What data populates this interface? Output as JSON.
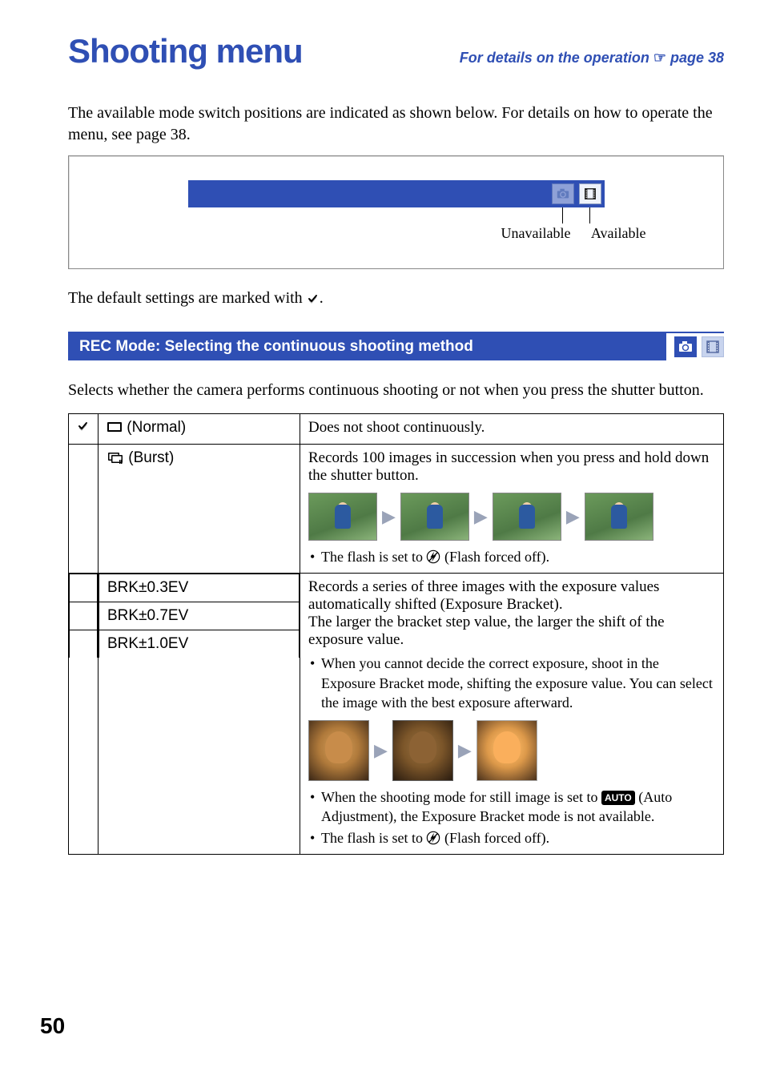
{
  "header": {
    "chapter_title": "Shooting menu",
    "ref_prefix": "For details on the operation ",
    "ref_page": "page 38"
  },
  "intro": {
    "text": "The available mode switch positions are indicated as shown below. For details on how to operate the menu, see page 38."
  },
  "diagram": {
    "unavailable_label": "Unavailable",
    "available_label": "Available"
  },
  "default_line": {
    "prefix": "The default settings are marked with ",
    "suffix": "."
  },
  "section": {
    "title": "REC Mode: Selecting the continuous shooting method",
    "description": "Selects whether the camera performs continuous shooting or not when you press the shutter button."
  },
  "table": {
    "normal": {
      "label": " (Normal)",
      "desc": "Does not shoot continuously."
    },
    "burst": {
      "label": " (Burst)",
      "desc": "Records 100 images in succession when you press and hold down the shutter button.",
      "note1_a": "The flash is set to ",
      "note1_b": " (Flash forced off)."
    },
    "brk": {
      "opt1": "BRK±0.3EV",
      "opt2": "BRK±0.7EV",
      "opt3": "BRK±1.0EV",
      "desc_p1": "Records a series of three images with the exposure values automatically shifted (Exposure Bracket).",
      "desc_p2": "The larger the bracket step value, the larger the shift of the exposure value.",
      "note_expo": "When you cannot decide the correct exposure, shoot in the Exposure Bracket mode, shifting the exposure value. You can select the image with the best exposure afterward.",
      "note_auto_a": "When the shooting mode for still image is set to ",
      "note_auto_b": " (Auto Adjustment), the Exposure Bracket mode is not available.",
      "note_flash_a": "The flash is set to ",
      "note_flash_b": " (Flash forced off).",
      "auto_label": "AUTO"
    }
  },
  "page_number": "50"
}
